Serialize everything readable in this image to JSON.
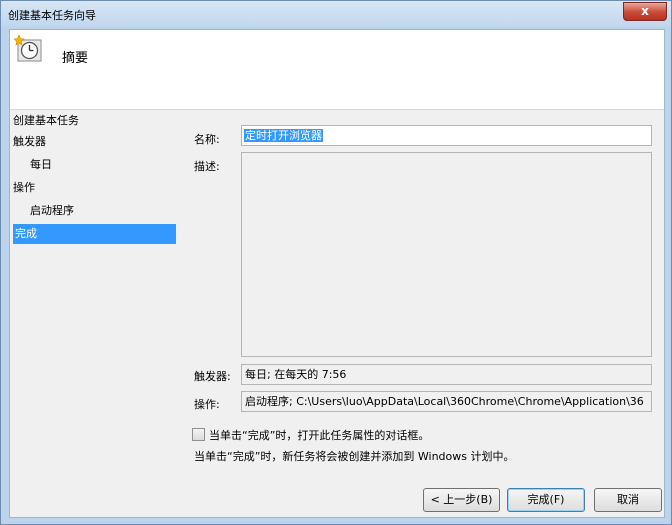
{
  "window": {
    "title": "创建基本任务向导",
    "close_glyph": "x"
  },
  "header": {
    "title": "摘要",
    "icon": "clock-task-icon"
  },
  "steps": [
    {
      "label": "创建基本任务"
    },
    {
      "label": "触发器"
    },
    {
      "label": "每日"
    },
    {
      "label": "操作"
    },
    {
      "label": "启动程序"
    },
    {
      "label": "完成"
    }
  ],
  "summary": {
    "name_label": "名称:",
    "name_value": "定时打开浏览器",
    "description_label": "描述:",
    "description_value": "",
    "trigger_label": "触发器:",
    "trigger_value": "每日; 在每天的 7:56",
    "action_label": "操作:",
    "action_value": "启动程序; C:\\Users\\luo\\AppData\\Local\\360Chrome\\Chrome\\Application\\36"
  },
  "checkbox": {
    "label": "当单击“完成”时，打开此任务属性的对话框。",
    "checked": false
  },
  "note": "当单击“完成”时，新任务将会被创建并添加到 Windows 计划中。",
  "buttons": {
    "back": "< 上一步(B)",
    "finish": "完成(F)",
    "cancel": "取消"
  },
  "colors": {
    "selection": "#3399ff"
  }
}
